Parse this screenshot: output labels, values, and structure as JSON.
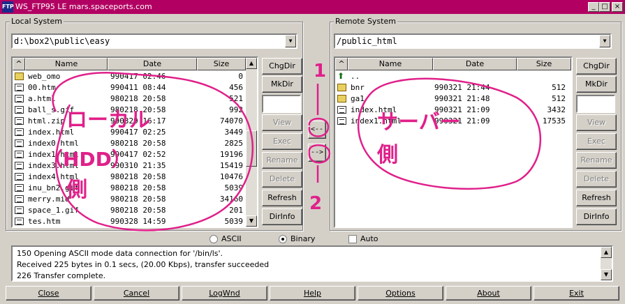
{
  "window": {
    "title": "WS_FTP95 LE mars.spaceports.com",
    "icon_text": "FTP",
    "minimize": "_",
    "maximize": "□",
    "close": "×"
  },
  "local": {
    "group_label": "Local System",
    "path": "d:\\box2\\public\\easy",
    "columns": {
      "sort": "^",
      "name": "Name",
      "date": "Date",
      "size": "Size"
    },
    "files": [
      {
        "icon": "folder",
        "name": "web_omo",
        "date": "990417 02:46",
        "size": "0"
      },
      {
        "icon": "file",
        "name": "00.htm",
        "date": "990411 08:44",
        "size": "456"
      },
      {
        "icon": "file",
        "name": "a.html",
        "date": "980218 20:58",
        "size": "521"
      },
      {
        "icon": "file",
        "name": "ball_s.gif",
        "date": "980218 20:58",
        "size": "992"
      },
      {
        "icon": "file",
        "name": "html.zip",
        "date": "990329 16:17",
        "size": "74070"
      },
      {
        "icon": "file",
        "name": "index.html",
        "date": "990417 02:25",
        "size": "3449"
      },
      {
        "icon": "file",
        "name": "index0.html",
        "date": "980218 20:58",
        "size": "2825"
      },
      {
        "icon": "file",
        "name": "index1.html",
        "date": "990417 02:52",
        "size": "19196"
      },
      {
        "icon": "file",
        "name": "index3.html",
        "date": "990310 21:35",
        "size": "15419"
      },
      {
        "icon": "file",
        "name": "index4.html",
        "date": "980218 20:58",
        "size": "10476"
      },
      {
        "icon": "file",
        "name": "inu_bn2.gif",
        "date": "980218 20:58",
        "size": "5039"
      },
      {
        "icon": "file",
        "name": "merry.mid",
        "date": "980218 20:58",
        "size": "34160"
      },
      {
        "icon": "file",
        "name": "space_1.gif",
        "date": "980218 20:58",
        "size": "201"
      },
      {
        "icon": "file",
        "name": "tes.htm",
        "date": "990328 14:59",
        "size": "5039"
      }
    ],
    "buttons": {
      "chgdir": "ChgDir",
      "mkdir": "MkDir",
      "view": "View",
      "exec": "Exec",
      "rename": "Rename",
      "delete": "Delete",
      "refresh": "Refresh",
      "dirinfo": "DirInfo"
    }
  },
  "remote": {
    "group_label": "Remote System",
    "path": "/public_html",
    "columns": {
      "sort": "^",
      "name": "Name",
      "date": "Date",
      "size": "Size"
    },
    "files": [
      {
        "icon": "up",
        "name": "..",
        "date": "",
        "size": ""
      },
      {
        "icon": "folder",
        "name": "bnr",
        "date": "990321 21:44",
        "size": "512"
      },
      {
        "icon": "folder",
        "name": "ga1",
        "date": "990321 21:48",
        "size": "512"
      },
      {
        "icon": "file",
        "name": "index.html",
        "date": "990321 21:09",
        "size": "3432"
      },
      {
        "icon": "file",
        "name": "index1.html",
        "date": "990321 21:09",
        "size": "17535"
      }
    ],
    "buttons": {
      "chgdir": "ChgDir",
      "mkdir": "MkDir",
      "view": "View",
      "exec": "Exec",
      "rename": "Rename",
      "delete": "Delete",
      "refresh": "Refresh",
      "dirinfo": "DirInfo"
    }
  },
  "transfer": {
    "download": "<--",
    "upload": "-->"
  },
  "mode": {
    "ascii": "ASCII",
    "binary": "Binary",
    "binary_selected": true,
    "auto": "Auto",
    "auto_checked": false
  },
  "log": [
    "150 Opening ASCII mode data connection for '/bin/ls'.",
    "Received 225 bytes in 0.1 secs, (20.00 Kbps), transfer succeeded",
    "226 Transfer complete."
  ],
  "bottom_buttons": {
    "close": "Close",
    "cancel": "Cancel",
    "logwnd": "LogWnd",
    "help": "Help",
    "options": "Options",
    "about": "About",
    "exit": "Exit"
  },
  "annotations": {
    "color": "#e0208a",
    "local_label_line1": "ローカル",
    "local_label_line2": "（HDD）",
    "local_label_line3": "側",
    "remote_label_line1": "サーバー",
    "remote_label_line2": "側",
    "download_number": "1",
    "upload_number": "2"
  }
}
